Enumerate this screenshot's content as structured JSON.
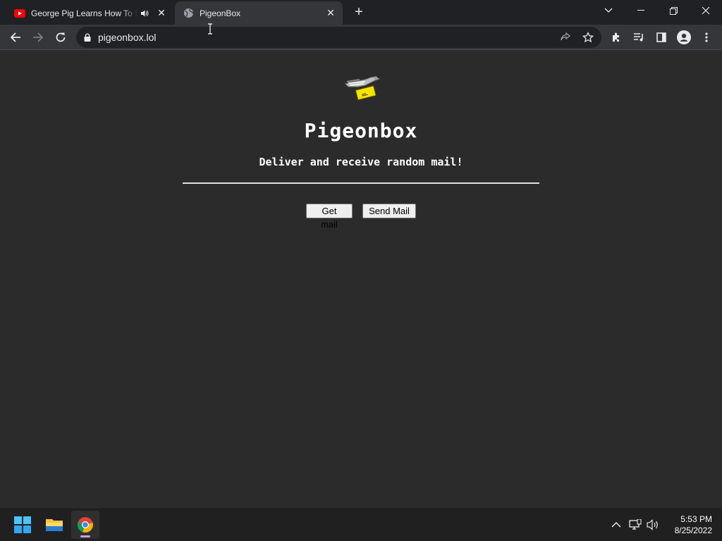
{
  "browser": {
    "tabs": [
      {
        "title": "George Pig Learns How To Swim",
        "favicon": "youtube-icon",
        "audio": "speaker-icon",
        "active": false
      },
      {
        "title": "PigeonBox",
        "favicon": "globe-icon",
        "active": true
      }
    ],
    "url": "pigeonbox.lol"
  },
  "page": {
    "title": "Pigeonbox",
    "tagline": "Deliver and receive random mail!",
    "buttons": {
      "get_mail": "Get mail",
      "send_mail": "Send Mail"
    }
  },
  "taskbar": {
    "time": "5:53 PM",
    "date": "8/25/2022"
  },
  "colors": {
    "page_bg": "#2b2b2b",
    "chrome_dark": "#202124",
    "chrome_tab": "#35363a",
    "youtube_red": "#ff0000",
    "envelope_yellow": "#f5e400"
  }
}
